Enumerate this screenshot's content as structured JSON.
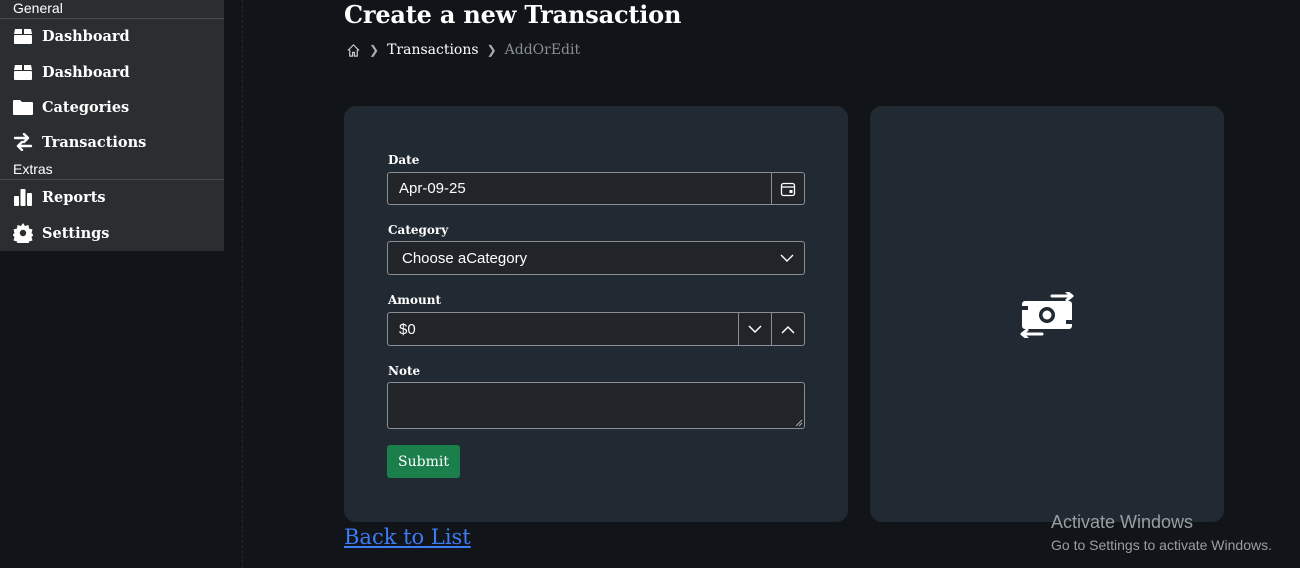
{
  "sidebar": {
    "sections": [
      {
        "title": "General"
      },
      {
        "title": "Extras"
      }
    ],
    "items": [
      {
        "label": "Dashboard",
        "icon": "box-icon"
      },
      {
        "label": "Dashboard",
        "icon": "box-icon"
      },
      {
        "label": "Categories",
        "icon": "folder-icon"
      },
      {
        "label": "Transactions",
        "icon": "arrows-exchange-icon"
      },
      {
        "label": "Reports",
        "icon": "bar-chart-icon"
      },
      {
        "label": "Settings",
        "icon": "gear-icon"
      }
    ]
  },
  "header": {
    "title": "Create a new Transaction",
    "breadcrumb": {
      "home_icon": "home-icon",
      "link": "Transactions",
      "current": "AddOrEdit"
    }
  },
  "form": {
    "date": {
      "label": "Date",
      "value": "Apr-09-25",
      "icon": "calendar-icon"
    },
    "category": {
      "label": "Category",
      "value": "Choose aCategory",
      "icon": "chevron-down-icon"
    },
    "amount": {
      "label": "Amount",
      "value": "$0"
    },
    "note": {
      "label": "Note",
      "value": ""
    },
    "submit_label": "Submit"
  },
  "image_card": {
    "icon": "money-bill-transfer-icon"
  },
  "back_link": "Back to List",
  "watermark": {
    "title": "Activate Windows",
    "subtitle": "Go to Settings to activate Windows."
  },
  "colors": {
    "page_bg": "#111419",
    "sidebar_bg": "#2b2e30",
    "card_bg": "#212a33",
    "input_bg": "#212429",
    "submit_bg": "#1b7f4c",
    "link": "#3d7cf7"
  }
}
